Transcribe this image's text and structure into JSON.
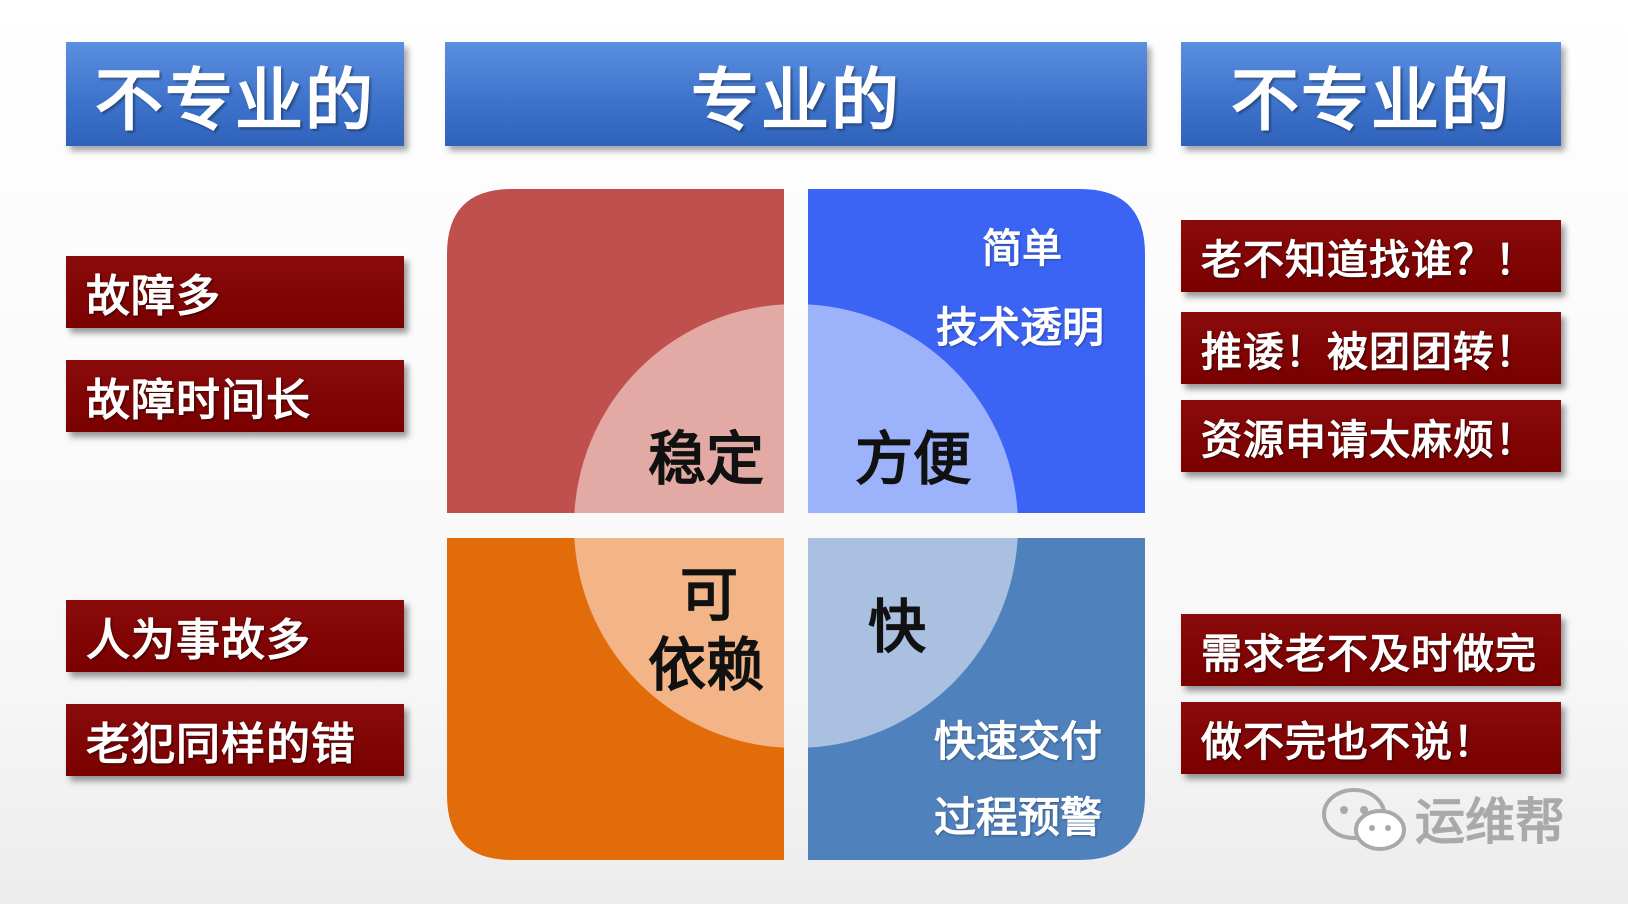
{
  "headers": {
    "left": "不专业的",
    "center": "专业的",
    "right": "不专业的"
  },
  "left_items": [
    "故障多",
    "故障时间长",
    "人为事故多",
    "老犯同样的错"
  ],
  "right_items": [
    "老不知道找谁？！",
    "推诿！被团团转！",
    "资源申请太麻烦！",
    "需求老不及时做完",
    "做不完也不说！"
  ],
  "quadrants": {
    "top_left": {
      "center": "稳定"
    },
    "top_right": {
      "center": "方便",
      "points": [
        "简单",
        "技术透明"
      ]
    },
    "bottom_left": {
      "center_line1": "可",
      "center_line2": "依赖"
    },
    "bottom_right": {
      "center": "快",
      "points": [
        "快速交付",
        "过程预警"
      ]
    }
  },
  "watermark": {
    "text": "运维帮",
    "icon": "wechat-icon"
  },
  "colors": {
    "header_blue": "#3f74cc",
    "item_red": "#7a0000",
    "q_red": "#bf504d",
    "q_blue": "#3b64f4",
    "q_orange": "#e36c0a",
    "q_steel": "#4f81bd"
  }
}
